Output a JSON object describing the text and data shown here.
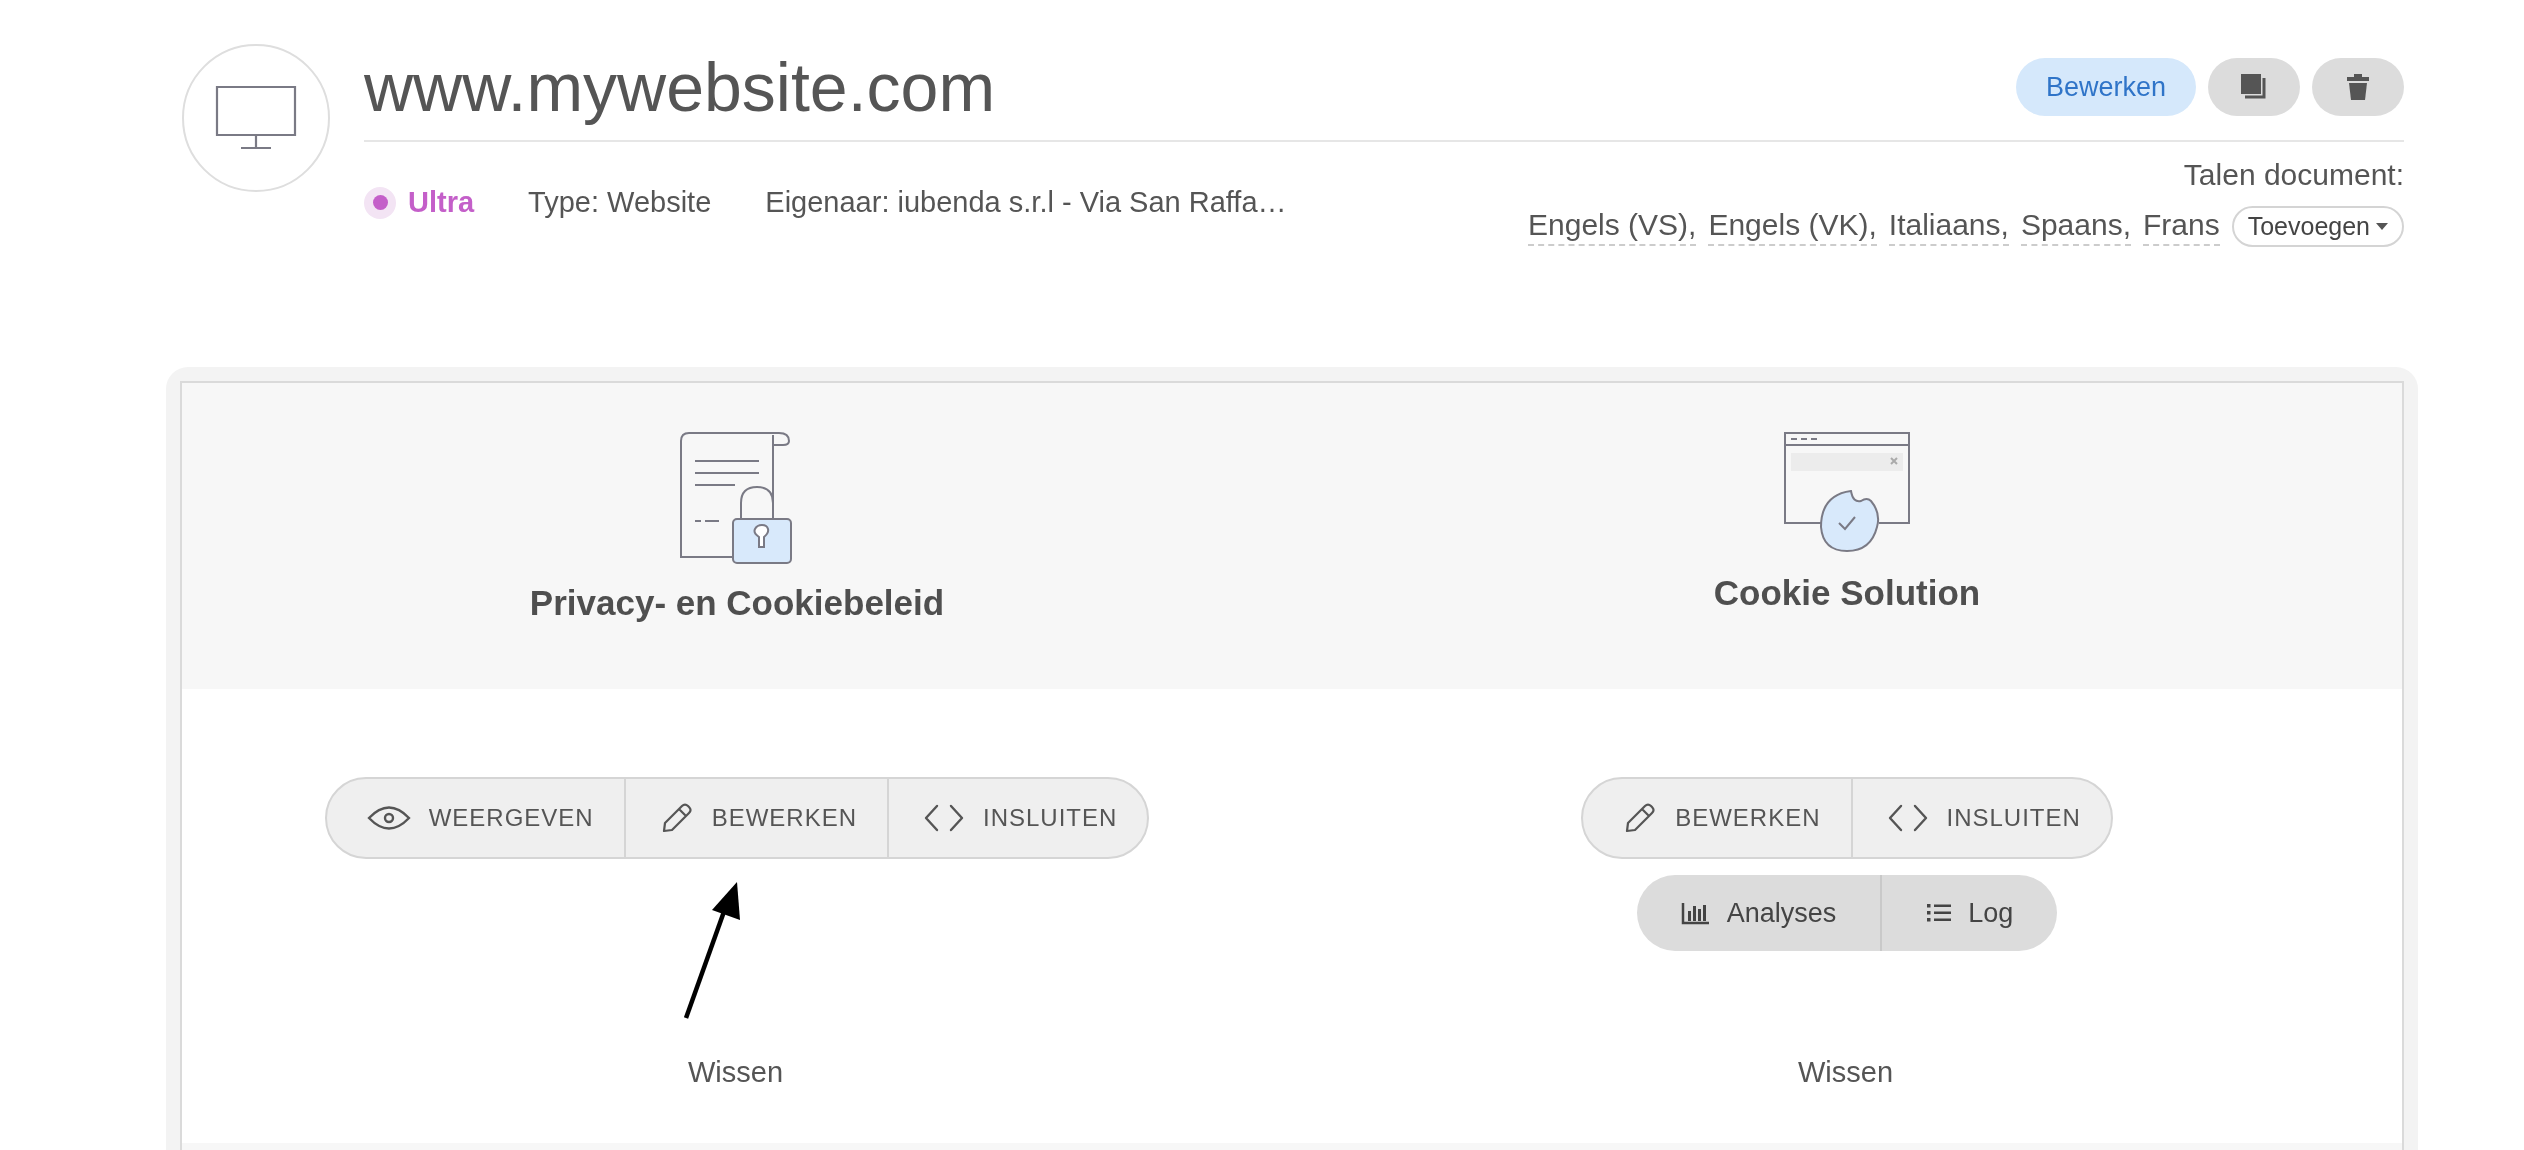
{
  "site": {
    "title": "www.mywebsite.com",
    "plan": {
      "label": "Ultra",
      "color": "#c45fc9"
    },
    "type": "Type: Website",
    "owner": "Eigenaar: iubenda s.r.l - Via San Raffa…"
  },
  "toolbar": {
    "edit": "Bewerken"
  },
  "languages": {
    "label": "Talen document:",
    "items": [
      "Engels (VS),",
      "Engels (VK),",
      "Italiaans,",
      "Spaans,",
      "Frans"
    ],
    "add": "Toevoegen"
  },
  "products": [
    {
      "kind": "policy",
      "title": "Privacy- en Cookiebeleid",
      "actions": [
        {
          "kind": "view",
          "label": "WEERGEVEN"
        },
        {
          "kind": "edit",
          "label": "BEWERKEN"
        },
        {
          "kind": "embed",
          "label": "INSLUITEN"
        }
      ],
      "delete": "Wissen"
    },
    {
      "kind": "cookie",
      "title": "Cookie Solution",
      "actions": [
        {
          "kind": "edit",
          "label": "BEWERKEN"
        },
        {
          "kind": "embed",
          "label": "INSLUITEN"
        }
      ],
      "secondary_actions": [
        {
          "kind": "analytics",
          "label": "Analyses"
        },
        {
          "kind": "log",
          "label": "Log"
        }
      ],
      "delete": "Wissen"
    }
  ]
}
